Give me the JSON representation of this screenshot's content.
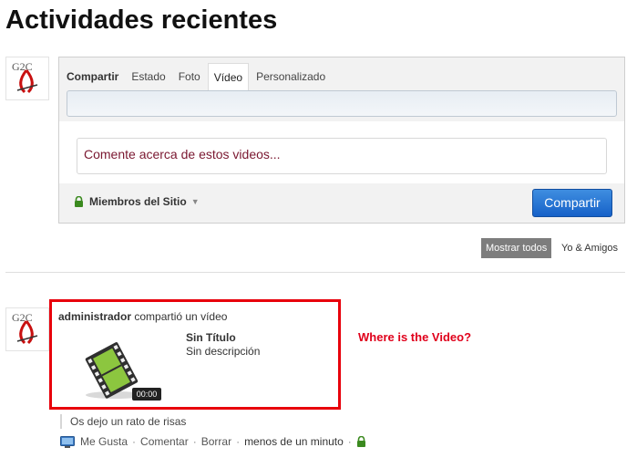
{
  "page": {
    "title": "Actividades recientes"
  },
  "composer": {
    "tabs": [
      "Compartir",
      "Estado",
      "Foto",
      "Vídeo",
      "Personalizado"
    ],
    "active_tab": "Vídeo",
    "comment_placeholder": "Comente acerca de estos videos...",
    "privacy_label": "Miembros del Sitio",
    "submit_label": "Compartir"
  },
  "filters": {
    "all": "Mostrar todos",
    "friends": "Yo & Amigos"
  },
  "activity": {
    "actor": "administrador",
    "action": "compartió un vídeo",
    "video": {
      "title": "Sin Título",
      "description": "Sin descripción",
      "duration": "00:00"
    },
    "caption": "Os dejo un rato de risas",
    "actions": {
      "like": "Me Gusta",
      "comment": "Comentar",
      "delete": "Borrar",
      "time": "menos de un minuto"
    }
  },
  "annotation": "Where is the Video?",
  "colors": {
    "accent_blue": "#1661c8",
    "annotation_red": "#e0001b",
    "comment_text": "#7a1730"
  }
}
